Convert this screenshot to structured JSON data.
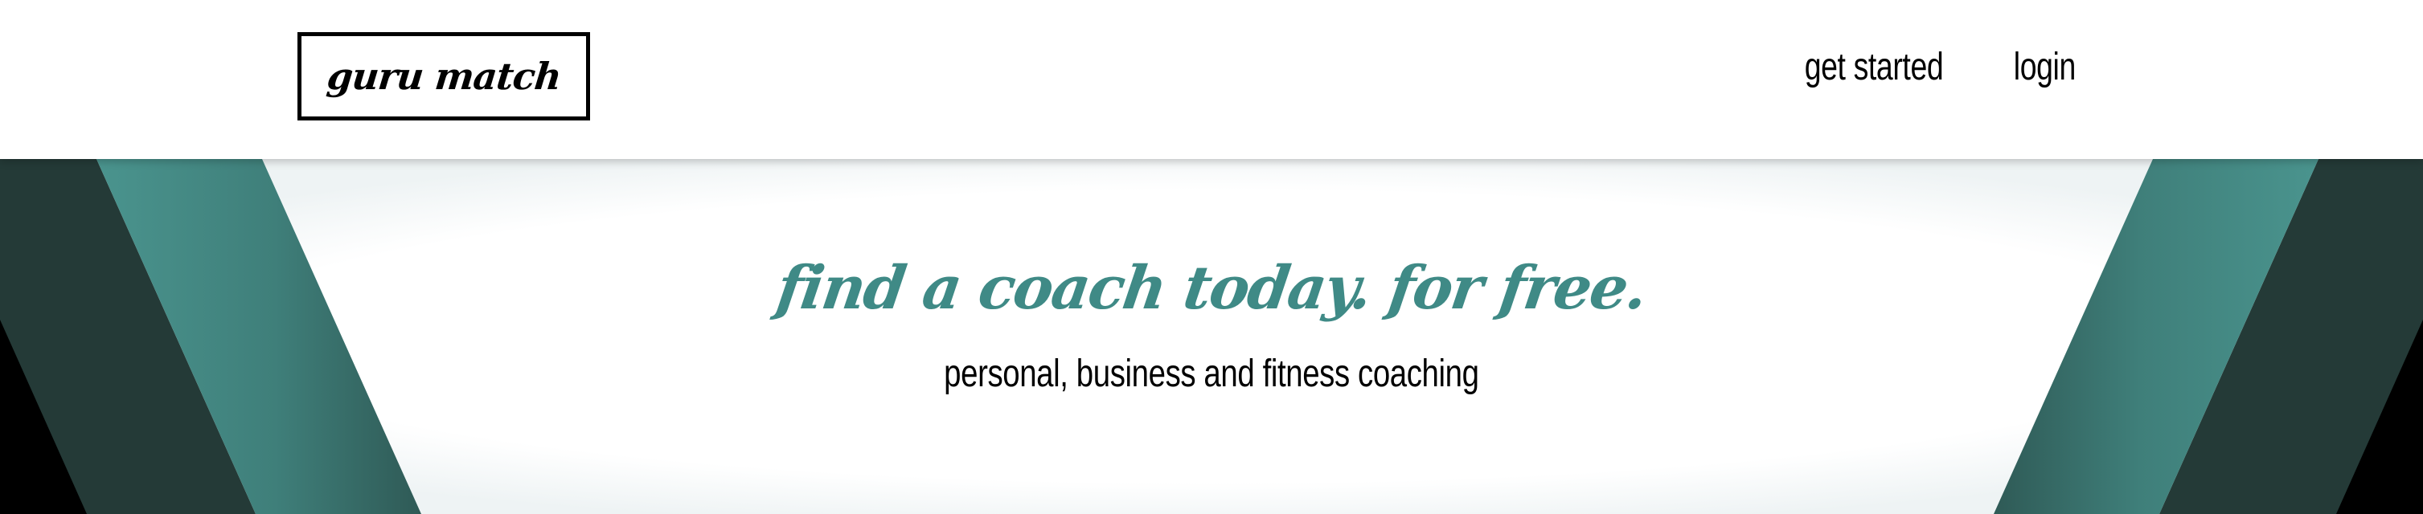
{
  "header": {
    "logo": "guru match",
    "nav": {
      "get_started": "get started",
      "login": "login"
    }
  },
  "hero": {
    "title": "find a coach today. for free.",
    "subtitle": "personal, business and fitness coaching"
  },
  "colors": {
    "accent_teal": "#3f8a86",
    "dark_teal": "#243a37",
    "black": "#000000",
    "background": "#ffffff"
  }
}
